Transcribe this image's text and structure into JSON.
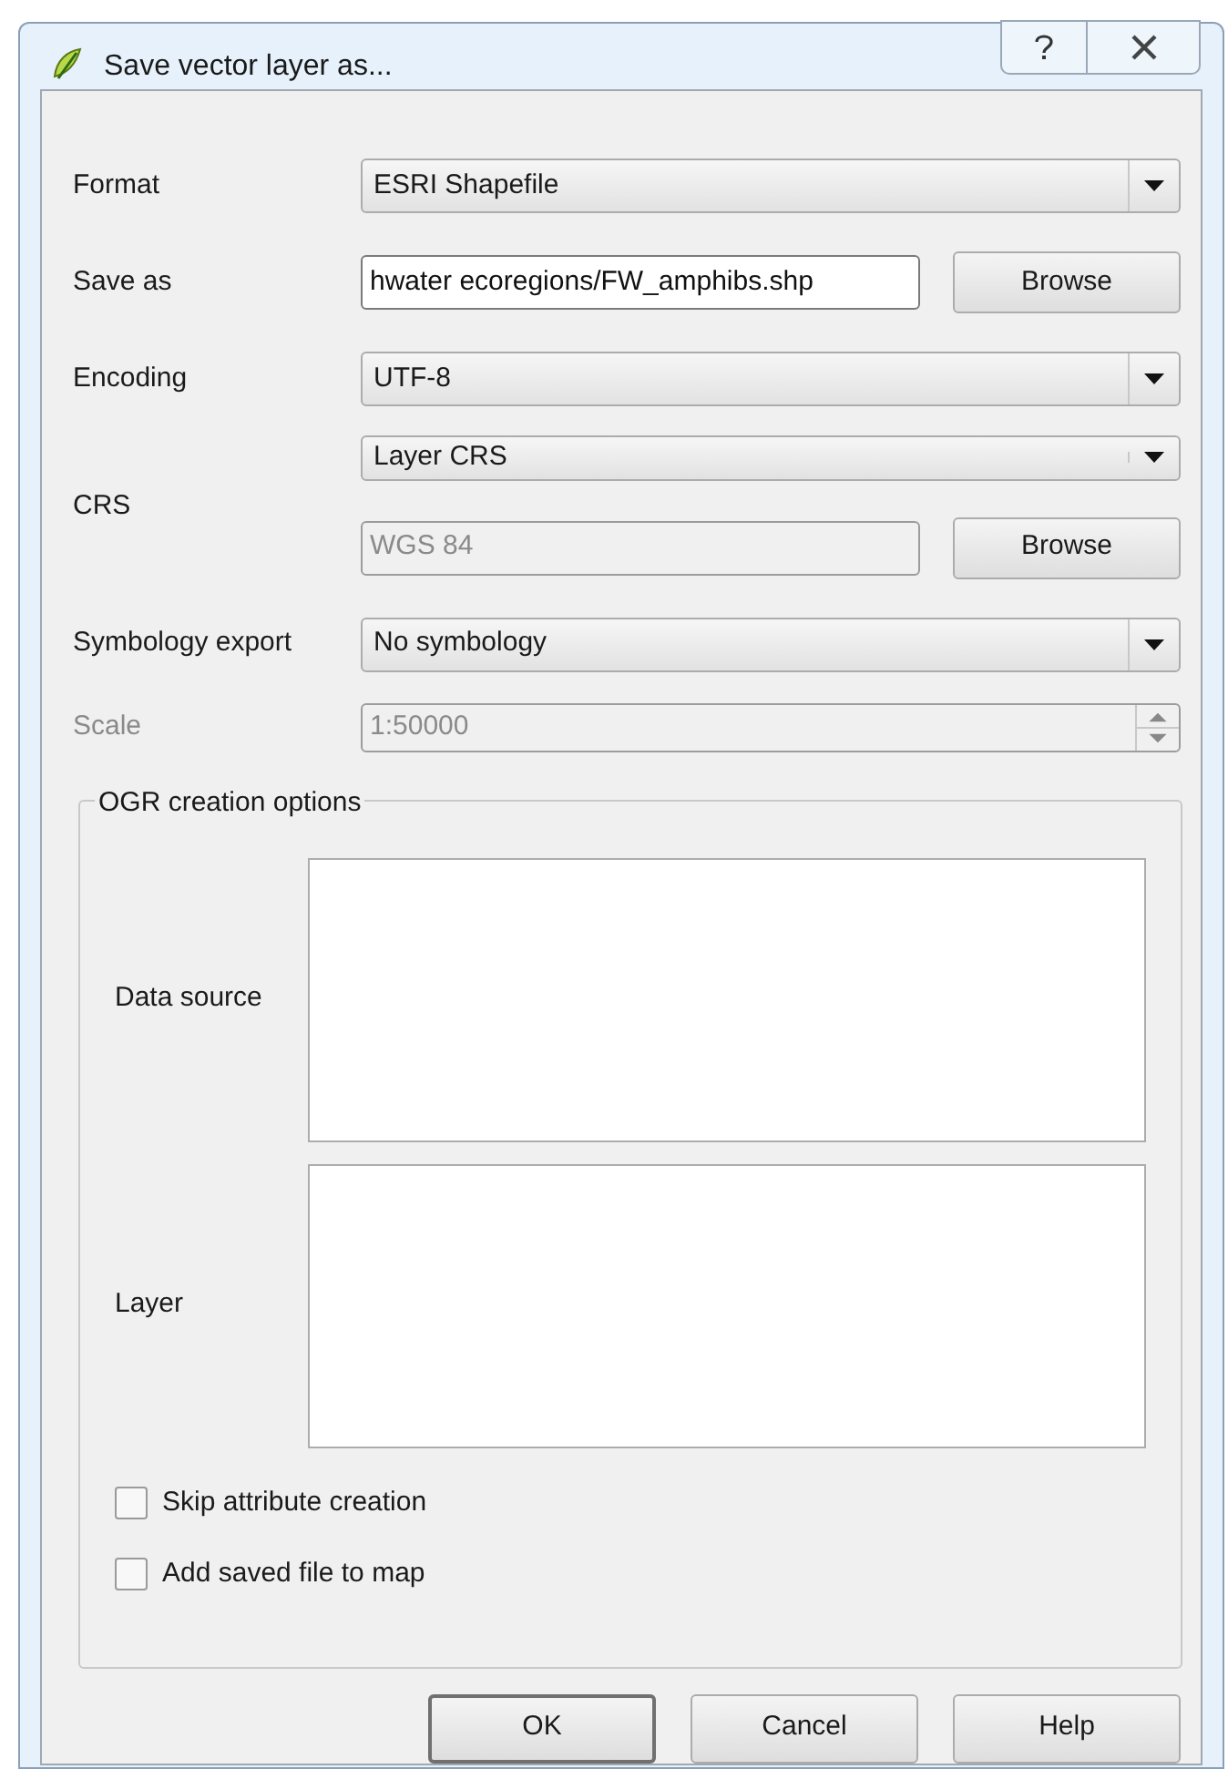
{
  "window": {
    "title": "Save vector layer as..."
  },
  "fields": [
    {
      "kind": "dropdown",
      "label": "Format",
      "value": "ESRI Shapefile",
      "disabled": false
    },
    {
      "kind": "file",
      "label": "Save as",
      "value": "hwater ecoregions/FW_amphibs.shp",
      "button": "Browse",
      "disabled": false
    },
    {
      "kind": "dropdown",
      "label": "Encoding",
      "value": "UTF-8",
      "disabled": false
    },
    {
      "kind": "crs",
      "label": "CRS",
      "value": "Layer CRS",
      "crs_field": {
        "value": "WGS 84",
        "disabled": true
      },
      "button": "Browse",
      "disabled": false
    },
    {
      "kind": "dropdown",
      "label": "Symbology export",
      "value": "No symbology",
      "disabled": false
    },
    {
      "kind": "spin",
      "label": "Scale",
      "value": "1:50000",
      "disabled": true
    }
  ],
  "ogr": {
    "title": "OGR creation options",
    "fields": [
      {
        "label": "Data source"
      },
      {
        "label": "Layer"
      }
    ]
  },
  "checkboxes": [
    {
      "label": "Skip attribute creation",
      "checked": false
    },
    {
      "label": "Add saved file to map",
      "checked": false
    }
  ],
  "buttons": [
    {
      "label": "OK",
      "default": true
    },
    {
      "label": "Cancel",
      "default": false
    },
    {
      "label": "Help",
      "default": false
    }
  ]
}
